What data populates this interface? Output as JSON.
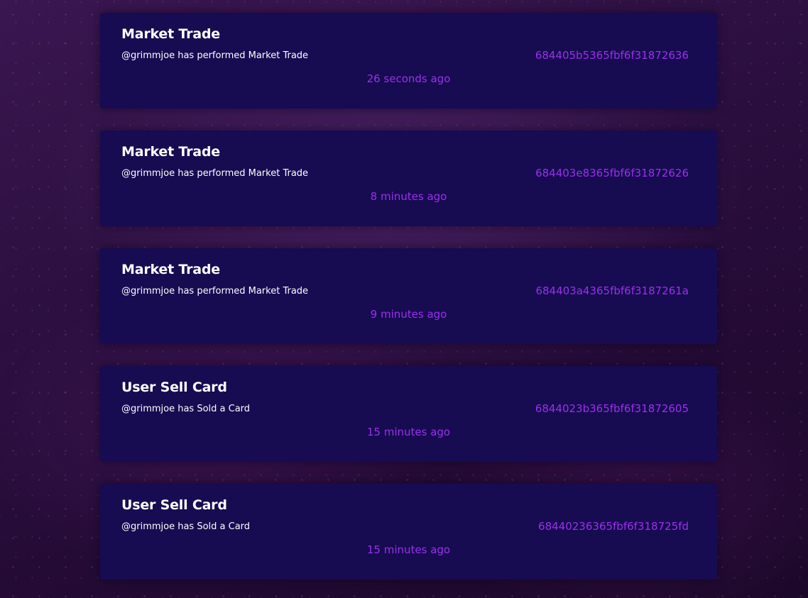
{
  "colors": {
    "card_bg": "#170b52",
    "accent": "#9b30ea",
    "text": "#ffffff"
  },
  "activities": [
    {
      "title": "Market Trade",
      "description": "@grimmjoe has performed Market Trade",
      "hash": "684405b5365fbf6f31872636",
      "time": "26 seconds ago"
    },
    {
      "title": "Market Trade",
      "description": "@grimmjoe has performed Market Trade",
      "hash": "684403e8365fbf6f31872626",
      "time": "8 minutes ago"
    },
    {
      "title": "Market Trade",
      "description": "@grimmjoe has performed Market Trade",
      "hash": "684403a4365fbf6f3187261a",
      "time": "9 minutes ago"
    },
    {
      "title": "User Sell Card",
      "description": "@grimmjoe has Sold a Card",
      "hash": "6844023b365fbf6f31872605",
      "time": "15 minutes ago"
    },
    {
      "title": "User Sell Card",
      "description": "@grimmjoe has Sold a Card",
      "hash": "68440236365fbf6f318725fd",
      "time": "15 minutes ago"
    }
  ]
}
